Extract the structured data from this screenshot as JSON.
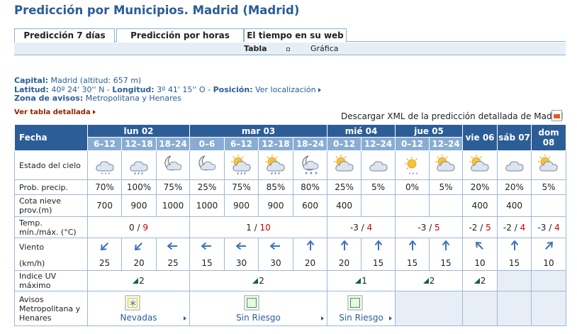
{
  "page": {
    "title": "Predicción por Municipios. Madrid (Madrid)"
  },
  "tabs": [
    {
      "label": "Predicción 7 días",
      "active": true
    },
    {
      "label": "Predicción por horas",
      "active": false
    },
    {
      "label": "El tiempo en su web",
      "active": false
    }
  ],
  "subtabs": {
    "tabla": "Tabla",
    "grafica": "Gráfica"
  },
  "info": {
    "capital_label": "Capital:",
    "capital_value": "Madrid (altitud: 657 m)",
    "latitud_label": "Latitud:",
    "latitud_value": "40º 24' 30'' N",
    "sep": "-",
    "longitud_label": "Longitud:",
    "longitud_value": "3º 41' 15'' O",
    "posicion_label": "Posición:",
    "posicion_link": "Ver localización",
    "zona_label": "Zona de avisos:",
    "zona_value": "Metropolitana y Henares"
  },
  "detail_link": "Ver tabla detallada",
  "download_text": "Descargar XML de la predicción detallada de Madrid",
  "forecast": {
    "fecha_label": "Fecha",
    "days": [
      {
        "label": "lun 02",
        "periods": [
          "6–12",
          "12–18",
          "18–24"
        ]
      },
      {
        "label": "mar 03",
        "periods": [
          "0–6",
          "6–12",
          "12–18",
          "18–24"
        ]
      },
      {
        "label": "mié 04",
        "periods": [
          "0–12",
          "12–24"
        ]
      },
      {
        "label": "jue 05",
        "periods": [
          "0–12",
          "12–24"
        ]
      },
      {
        "label": "vie 06",
        "periods": []
      },
      {
        "label": "sáb 07",
        "periods": []
      },
      {
        "label": "dom 08",
        "periods": []
      }
    ],
    "rows": {
      "estado": {
        "label": "Estado del cielo",
        "icons": [
          "cloud-drizzle-icon",
          "cloud-rain-icon",
          "moon-cloud-icon",
          "moon-cloud-icon",
          "sun-cloud-rain-icon",
          "sun-cloud-rain-icon",
          "moon-snow-icon",
          "sun-cloud-icon",
          "cloud-icon",
          "sun-drizzle-icon",
          "sun-cloud-icon",
          "sun-cloud-icon",
          "cloud-icon",
          "sun-cloud-icon"
        ]
      },
      "precip": {
        "label": "Prob. precip.",
        "values": [
          "70%",
          "100%",
          "75%",
          "25%",
          "75%",
          "85%",
          "80%",
          "25%",
          "5%",
          "0%",
          "5%",
          "20%",
          "20%",
          "5%"
        ]
      },
      "cota": {
        "label1": "Cota nieve",
        "label2": "prov.(m)",
        "values": [
          "700",
          "900",
          "1000",
          "1000",
          "900",
          "900",
          "600",
          "400",
          "",
          "",
          "",
          "400",
          "400",
          ""
        ]
      },
      "temp": {
        "label1": "Temp.",
        "label2": "mín./máx. (°C)",
        "values": [
          {
            "min": "0",
            "sep": " / ",
            "max": "9"
          },
          {
            "min": "1",
            "sep": " / ",
            "max": "10"
          },
          {
            "min": "-3",
            "sep": " / ",
            "max": "4"
          },
          {
            "min": "-3",
            "sep": " / ",
            "max": "5"
          },
          {
            "min": "-2",
            "sep": " / ",
            "max": "5"
          },
          {
            "min": "-2",
            "sep": " / ",
            "max": "4"
          },
          {
            "min": "-3",
            "sep": " / ",
            "max": "4"
          }
        ]
      },
      "viento": {
        "label": "Viento",
        "unit_label": "(km/h)",
        "arrows": [
          45,
          45,
          90,
          90,
          90,
          90,
          180,
          180,
          180,
          180,
          180,
          135,
          180,
          225
        ],
        "values": [
          "25",
          "20",
          "25",
          "15",
          "30",
          "30",
          "20",
          "20",
          "15",
          "15",
          "15",
          "10",
          "15",
          "10"
        ]
      },
      "uv": {
        "label1": "Indice UV",
        "label2": "máximo",
        "values": [
          "2",
          "2",
          "1",
          "2",
          "2",
          "",
          ""
        ]
      },
      "avisos": {
        "label1": "Avisos",
        "label2": "Metropolitana y",
        "label3": "Henares",
        "items": [
          {
            "name": "Nevadas",
            "level": "yellow",
            "icon": "snowflake-icon"
          },
          {
            "name": "Sin Riesgo",
            "level": "green",
            "icon": "no-risk-icon"
          },
          {
            "name": "Sin Riesgo",
            "level": "green",
            "icon": "no-risk-icon"
          }
        ]
      }
    }
  },
  "colors": {
    "title": "#2a5c98",
    "header": "#2d5d96",
    "subheader": "#89acd3",
    "link_red": "#8b2500",
    "arrow": "#3a73bd",
    "uv_flag": "#116633",
    "temp_max": "#cc0000"
  }
}
